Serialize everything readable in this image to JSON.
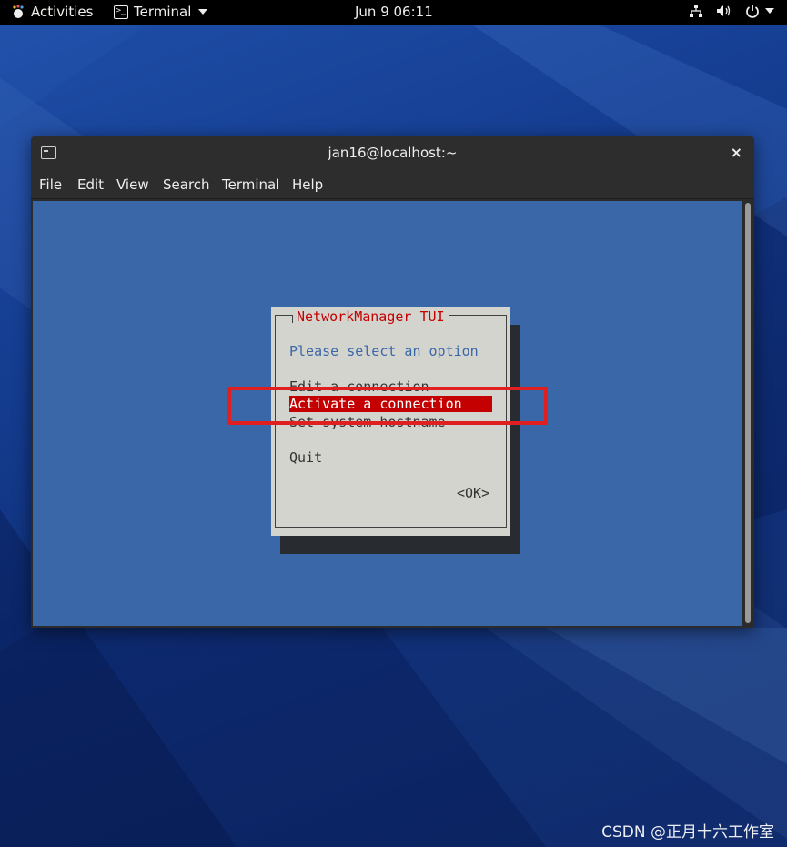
{
  "topbar": {
    "activities": "Activities",
    "app_menu": "Terminal",
    "clock": "Jun 9  06:11",
    "icons": [
      "network-icon",
      "volume-icon",
      "power-icon"
    ]
  },
  "window": {
    "title": "jan16@localhost:~",
    "close": "×",
    "menu": [
      "File",
      "Edit",
      "View",
      "Search",
      "Terminal",
      "Help"
    ]
  },
  "tui": {
    "title": "NetworkManager TUI",
    "prompt": "Please select an option",
    "options": [
      "Edit a connection",
      "Activate a connection",
      "Set system hostname",
      "Quit"
    ],
    "selected": "Activate a connection",
    "ok": "<OK>"
  },
  "watermark": "CSDN @正月十六工作室",
  "colors": {
    "terminal_bg": "#3a67a8",
    "dialog_bg": "#d4d4cf",
    "accent_red": "#c40000",
    "highlight": "#e02020"
  }
}
